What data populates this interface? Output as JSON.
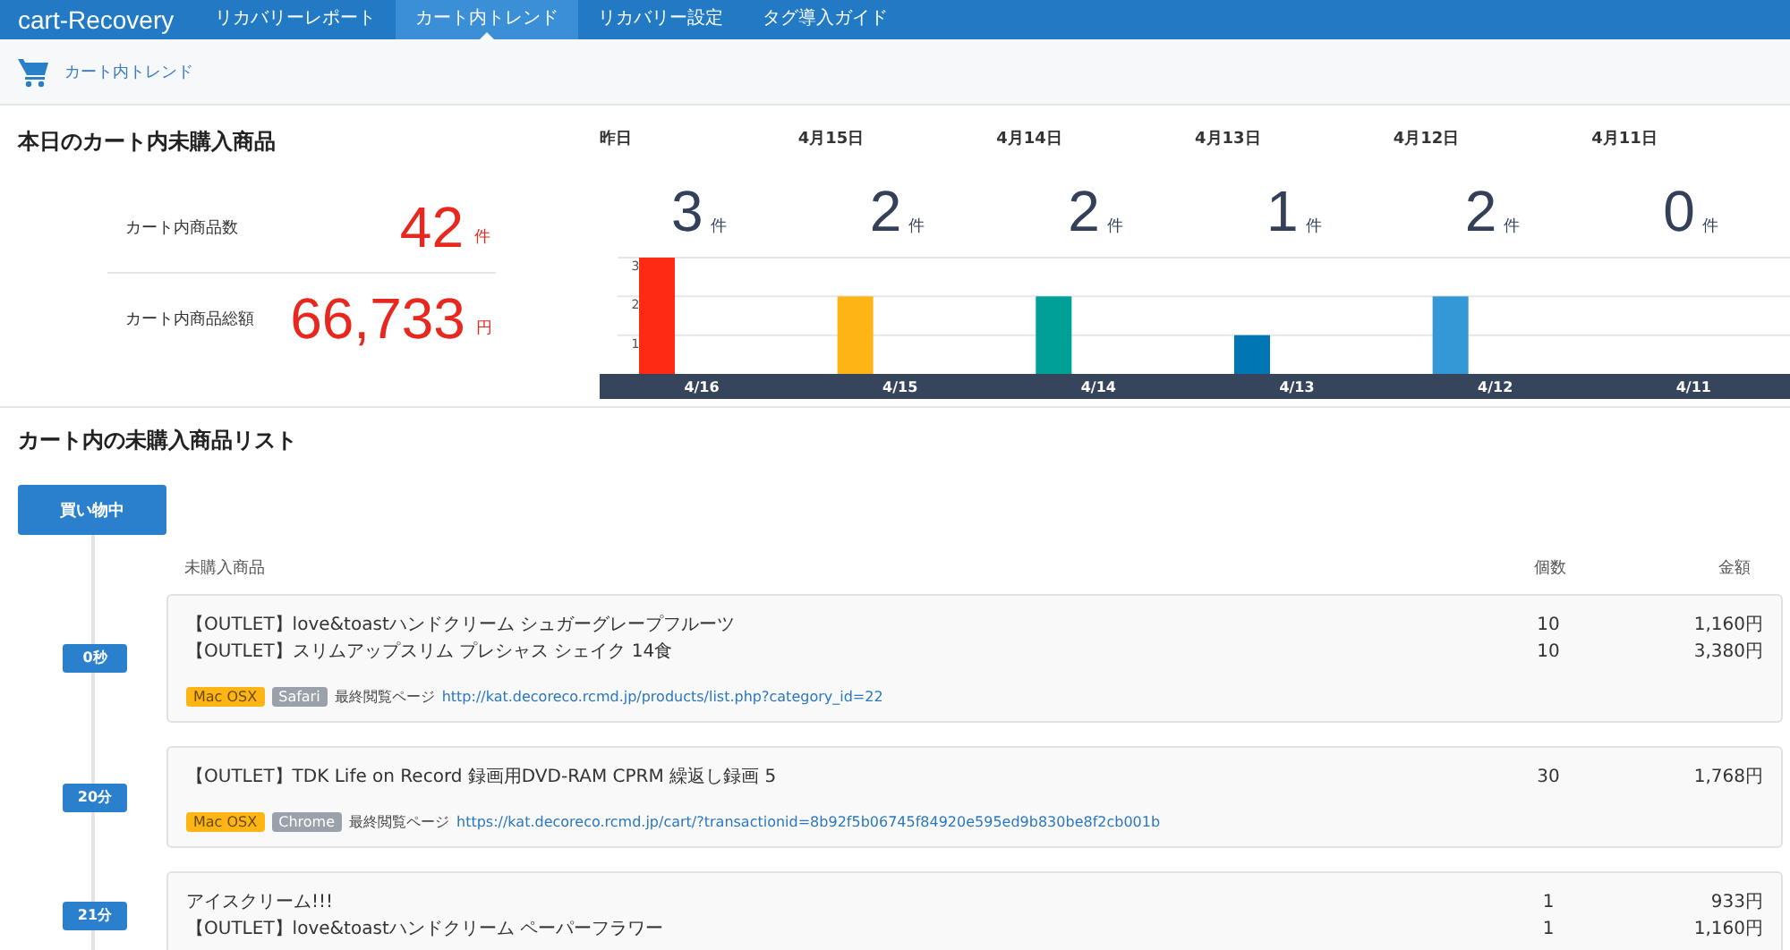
{
  "nav": {
    "brand": "cart-Recovery",
    "tabs": [
      {
        "label": "リカバリーレポート",
        "selected": false
      },
      {
        "label": "カート内トレンド",
        "selected": true
      },
      {
        "label": "リカバリー設定",
        "selected": false
      },
      {
        "label": "タグ導入ガイド",
        "selected": false
      }
    ]
  },
  "breadcrumb": {
    "label": "カート内トレンド"
  },
  "today": {
    "title": "本日のカート内未購入商品",
    "stats": [
      {
        "label": "カート内商品数",
        "value": "42",
        "unit": "件"
      },
      {
        "label": "カート内商品総額",
        "value": "66,733",
        "unit": "円"
      }
    ]
  },
  "days": [
    {
      "label": "昨日",
      "count": "3",
      "unit": "件"
    },
    {
      "label": "4月15日",
      "count": "2",
      "unit": "件"
    },
    {
      "label": "4月14日",
      "count": "2",
      "unit": "件"
    },
    {
      "label": "4月13日",
      "count": "1",
      "unit": "件"
    },
    {
      "label": "4月12日",
      "count": "2",
      "unit": "件"
    },
    {
      "label": "4月11日",
      "count": "0",
      "unit": "件"
    }
  ],
  "chart_data": {
    "type": "bar",
    "categories": [
      "4/16",
      "4/15",
      "4/14",
      "4/13",
      "4/12",
      "4/11"
    ],
    "values": [
      3,
      2,
      2,
      1,
      2,
      0
    ],
    "colors": [
      "#ff2a14",
      "#fdb515",
      "#00a096",
      "#0077b4",
      "#3497d6",
      "#cccccc"
    ],
    "ylim": [
      0,
      3
    ],
    "yticks": [
      1,
      2,
      3
    ]
  },
  "list": {
    "title": "カート内の未購入商品リスト",
    "status_button": "買い物中",
    "columns": [
      "未購入商品",
      "個数",
      "金額"
    ],
    "entries": [
      {
        "time": "0秒",
        "items": [
          {
            "name": "【OUTLET】love&toastハンドクリーム シュガーグレープフルーツ",
            "qty": "10",
            "amount": "1,160円"
          },
          {
            "name": "【OUTLET】スリムアップスリム プレシャス シェイク 14食",
            "qty": "10",
            "amount": "3,380円"
          }
        ],
        "os": "Mac OSX",
        "browser": "Safari",
        "last_page_label": "最終閲覧ページ",
        "last_page_url": "http://kat.decoreco.rcmd.jp/products/list.php?category_id=22"
      },
      {
        "time": "20分",
        "items": [
          {
            "name": "【OUTLET】TDK Life on Record 録画用DVD-RAM CPRM 繰返し録画 5",
            "qty": "30",
            "amount": "1,768円"
          }
        ],
        "os": "Mac OSX",
        "browser": "Chrome",
        "last_page_label": "最終閲覧ページ",
        "last_page_url": "https://kat.decoreco.rcmd.jp/cart/?transactionid=8b92f5b06745f84920e595ed9b830be8f2cb001b"
      },
      {
        "time": "21分",
        "items": [
          {
            "name": "アイスクリーム!!!",
            "qty": "1",
            "amount": "933円"
          },
          {
            "name": "【OUTLET】love&toastハンドクリーム ペーパーフラワー",
            "qty": "1",
            "amount": "1,160円"
          }
        ]
      }
    ]
  }
}
